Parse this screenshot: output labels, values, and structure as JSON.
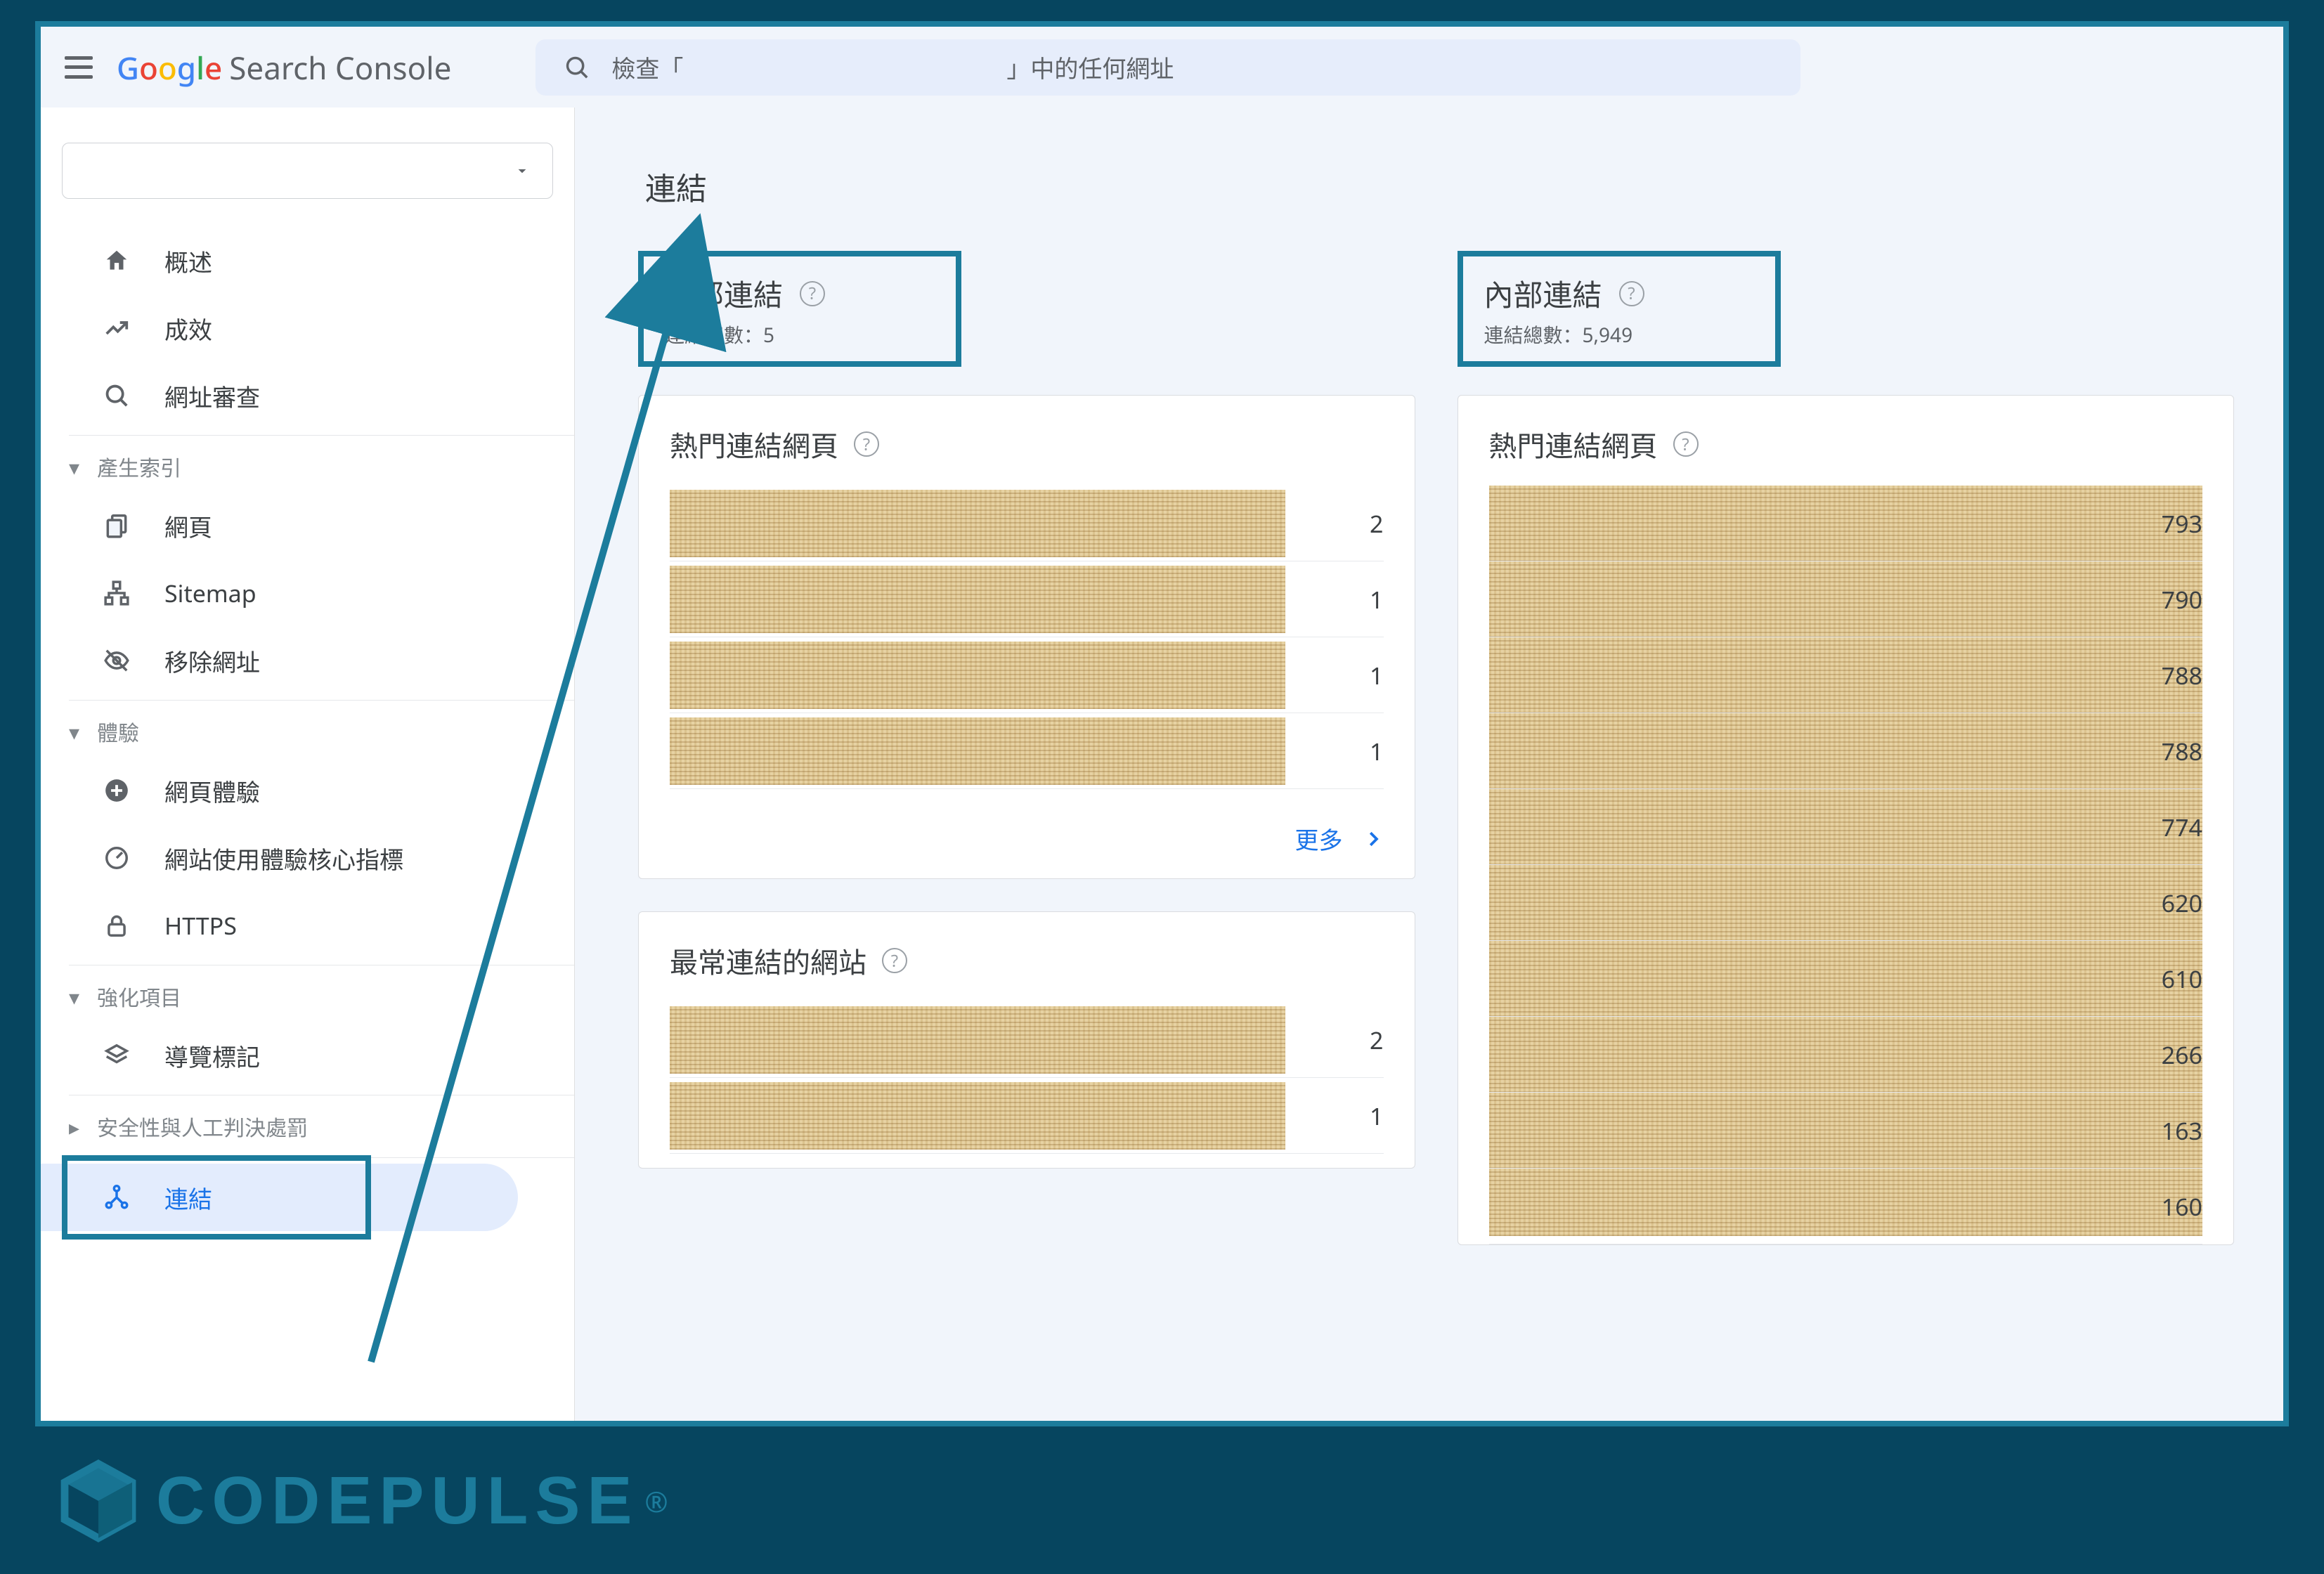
{
  "header": {
    "product": "Search Console",
    "search_prefix": "檢查「",
    "search_suffix": "」中的任何網址"
  },
  "sidebar": {
    "items": {
      "overview": "概述",
      "performance": "成效",
      "url_inspect": "網址審查",
      "pages": "網頁",
      "sitemap": "Sitemap",
      "removals": "移除網址",
      "page_exp": "網頁體驗",
      "cwv": "網站使用體驗核心指標",
      "https": "HTTPS",
      "breadcrumbs": "導覽標記",
      "links": "連結"
    },
    "groups": {
      "indexing": "產生索引",
      "experience": "體驗",
      "enhancements": "強化項目",
      "security": "安全性與人工判決處罰"
    }
  },
  "page": {
    "title": "連結",
    "external": {
      "title": "外部連結",
      "total_label": "連結總數：",
      "total_value": "5",
      "top_pages_title": "熱門連結網頁",
      "top_pages_values": [
        "2",
        "1",
        "1",
        "1"
      ],
      "top_sites_title": "最常連結的網站",
      "top_sites_values": [
        "2",
        "1"
      ],
      "more": "更多"
    },
    "internal": {
      "title": "內部連結",
      "total_label": "連結總數：",
      "total_value": "5,949",
      "top_pages_title": "熱門連結網頁",
      "top_pages_values": [
        "793",
        "790",
        "788",
        "788",
        "774",
        "620",
        "610",
        "266",
        "163",
        "160"
      ]
    }
  },
  "brand": {
    "name": "CODEPULSE"
  }
}
